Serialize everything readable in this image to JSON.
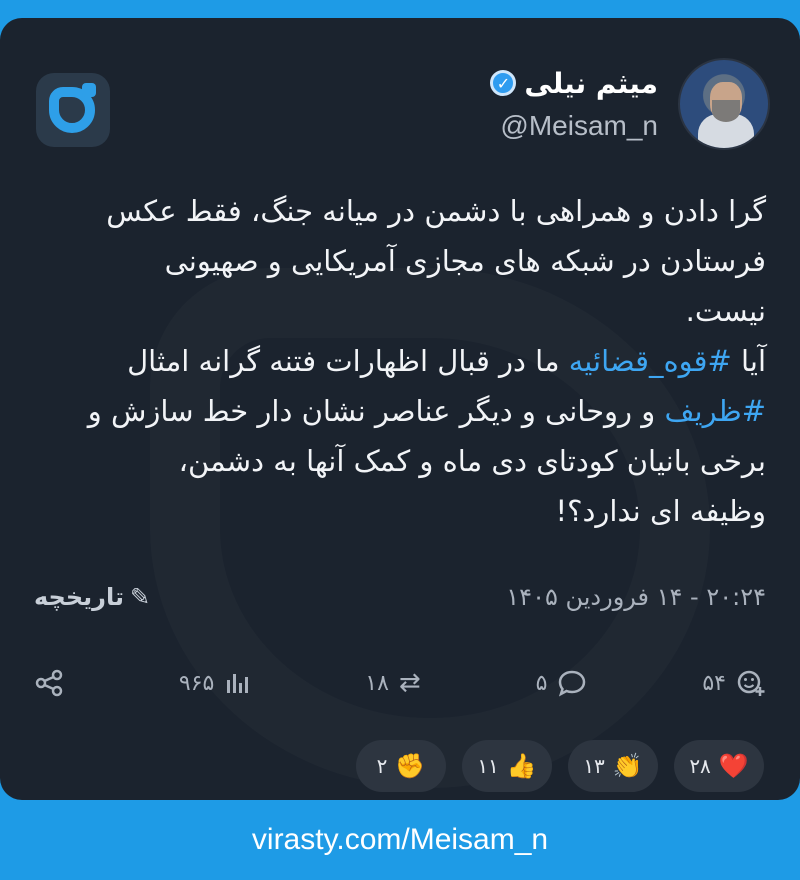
{
  "profile": {
    "display_name": "میثم نیلی",
    "handle": "@Meisam_n"
  },
  "post": {
    "line1": "گرا دادن و همراهی با دشمن در میانه جنگ، فقط عکس",
    "line2": "فرستادن در شبکه های مجازی آمریکایی و صهیونی",
    "line3": "نیست.",
    "line4_pre": "آیا",
    "hashtag1": "#قوه_قضائیه",
    "line4_post": "ما در قبال اظهارات فتنه گرانه امثال",
    "hashtag2": "#ظریف",
    "line5_post": "و روحانی و دیگر عناصر نشان دار خط سازش و",
    "line6": "برخی بانیان کودتای دی ماه و کمک آنها به دشمن،",
    "line7": "وظیفه ای ندارد؟!"
  },
  "meta": {
    "timestamp": "۲۰:۲۴ - ۱۴ فروردین ۱۴۰۵",
    "history_label": "تاریخچه"
  },
  "stats": {
    "reactions_count": "۵۴",
    "replies_count": "۵",
    "reposts_count": "۱۸",
    "views_count": "۹۶۵"
  },
  "reactions": [
    {
      "emoji": "❤️",
      "count": "۲۸"
    },
    {
      "emoji": "👏",
      "count": "۱۳"
    },
    {
      "emoji": "👍",
      "count": "۱۱"
    },
    {
      "emoji": "✊",
      "count": "۲"
    }
  ],
  "footer": {
    "url": "virasty.com/Meisam_n"
  },
  "colors": {
    "accent": "#2e9fe8",
    "card_bg": "#1b232e",
    "page_bg": "#1e9be6"
  }
}
